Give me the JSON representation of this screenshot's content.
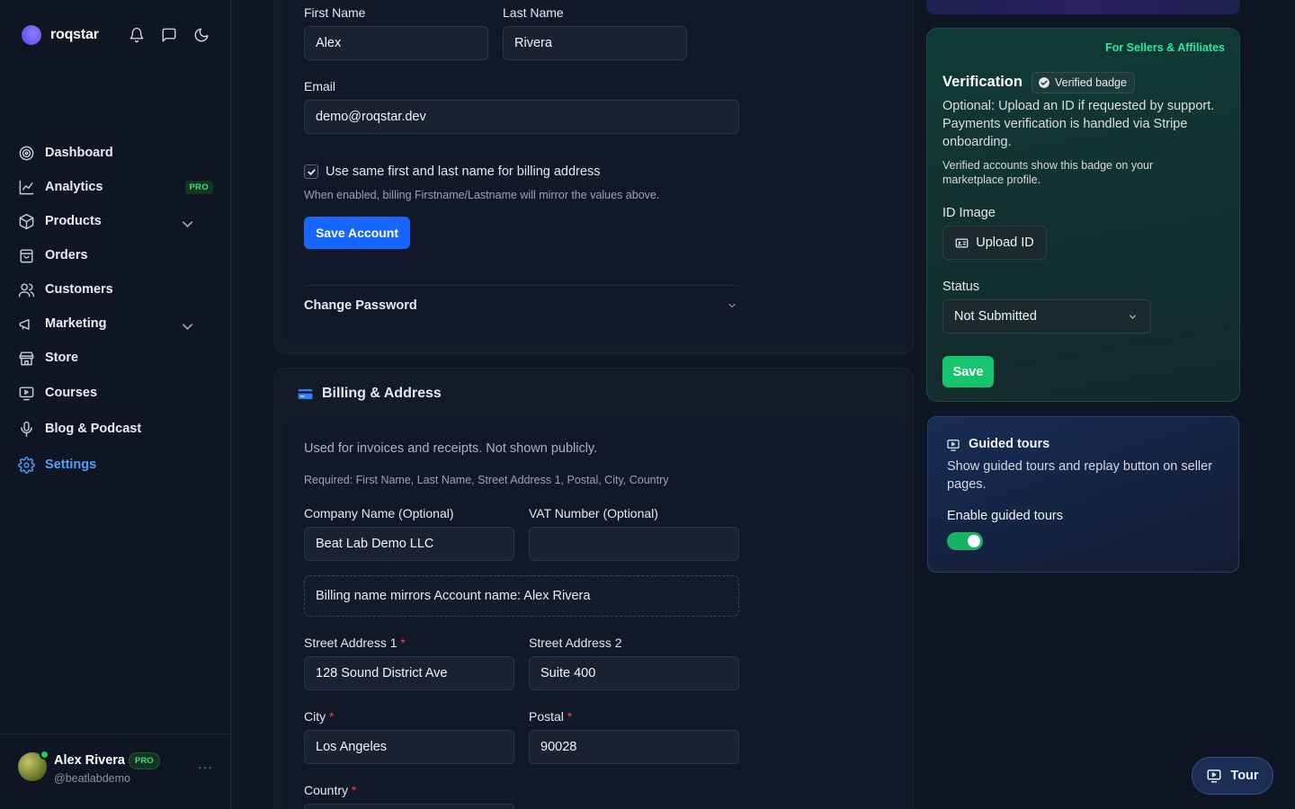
{
  "app": {
    "brand": "roqstar"
  },
  "sidebar": {
    "items": [
      {
        "label": "Dashboard",
        "icon": "dashboard-icon"
      },
      {
        "label": "Analytics",
        "icon": "analytics-icon",
        "badge": "PRO"
      },
      {
        "label": "Products",
        "icon": "box-icon"
      },
      {
        "label": "Orders",
        "icon": "bag-icon"
      },
      {
        "label": "Customers",
        "icon": "users-icon"
      },
      {
        "label": "Marketing",
        "icon": "megaphone-icon"
      },
      {
        "label": "Store",
        "icon": "store-icon"
      },
      {
        "label": "Courses",
        "icon": "presentation-icon"
      },
      {
        "label": "Blog & Podcast",
        "icon": "mic-icon"
      },
      {
        "label": "Settings",
        "icon": "gear-icon"
      }
    ]
  },
  "profile": {
    "name": "Alex Rivera",
    "badge": "PRO",
    "handle": "@beatlabdemo",
    "more": "···"
  },
  "account": {
    "first_name_label": "First Name",
    "first_name_value": "Alex",
    "last_name_label": "Last Name",
    "last_name_value": "Rivera",
    "email_label": "Email",
    "email_value": "demo@roqstar.dev",
    "same_name_label": "Use same first and last name for billing address",
    "same_name_help": "When enabled, billing Firstname/Lastname will mirror the values above.",
    "save_label": "Save Account",
    "change_password_label": "Change Password"
  },
  "billing": {
    "title": "Billing & Address",
    "intro": "Used for invoices and receipts. Not shown publicly.",
    "required_note": "Required: First Name, Last Name, Street Address 1, Postal, City, Country",
    "company_label": "Company Name (Optional)",
    "company_value": "Beat Lab Demo LLC",
    "vat_label": "VAT Number (Optional)",
    "vat_value": "",
    "mirror_note": "Billing name mirrors Account name: Alex Rivera",
    "street1_label": "Street Address 1",
    "street1_value": "128 Sound District Ave",
    "street2_label": "Street Address 2",
    "street2_value": "Suite 400",
    "city_label": "City",
    "city_value": "Los Angeles",
    "postal_label": "Postal",
    "postal_value": "90028",
    "country_label": "Country",
    "required_marker": "*"
  },
  "verification": {
    "tag": "For Sellers & Affiliates",
    "title": "Verification",
    "badge_label": "Verified badge",
    "desc": "Optional: Upload an ID if requested by support. Payments verification is handled via Stripe onboarding.",
    "note": "Verified accounts show this badge on your marketplace profile.",
    "id_label": "ID Image",
    "upload_label": "Upload ID",
    "status_label": "Status",
    "status_value": "Not Submitted",
    "save_label": "Save"
  },
  "tours": {
    "title": "Guided tours",
    "desc": "Show guided tours and replay button on seller pages.",
    "toggle_label": "Enable guided tours",
    "enabled": true,
    "tour_button": "Tour"
  },
  "colors": {
    "accent": "#1766ff",
    "active_nav": "#4ba3ff",
    "success": "#16b364",
    "required": "#ef4444"
  }
}
